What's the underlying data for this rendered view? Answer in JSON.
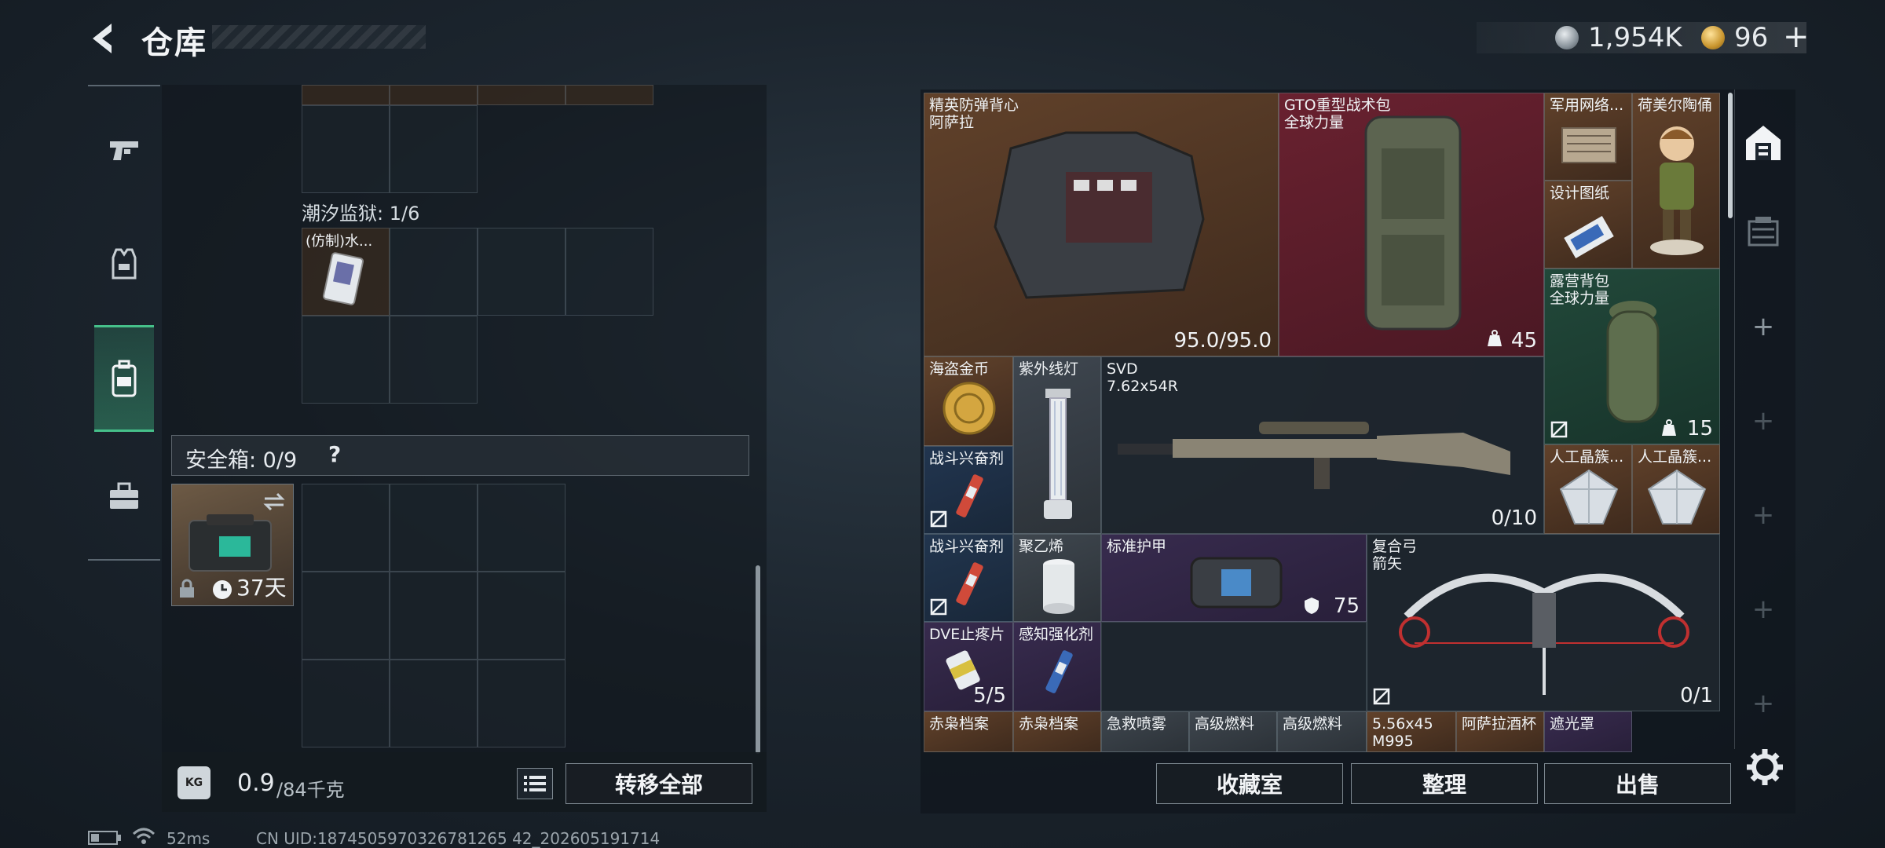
{
  "header": {
    "title": "仓库",
    "currency": {
      "silver_amount": "1,954K",
      "gold_amount": "96",
      "gold_plus": "+"
    }
  },
  "left_nav": {
    "tabs": [
      {
        "name": "weapons",
        "icon": "pistol-icon"
      },
      {
        "name": "equipment",
        "icon": "vest-icon"
      },
      {
        "name": "backpack",
        "icon": "backpack-icon",
        "active": true
      },
      {
        "name": "supplies",
        "icon": "toolbox-icon"
      }
    ]
  },
  "storage": {
    "tidal_prison_label": "潮汐监狱: 1/6",
    "tidal_item_name": "(仿制)水...",
    "safebox_label": "安全箱: 0/9",
    "safebox_help": "?",
    "safebox_days": "37天",
    "weight_value": "0.9",
    "weight_unit": "/84千克",
    "weight_icon_text": "KG",
    "transfer_all": "转移全部"
  },
  "inventory": {
    "items": [
      {
        "name": "精英防弹背心\n阿萨拉",
        "count": "95.0/95.0",
        "color": "brown"
      },
      {
        "name": "GTO重型战术包\n全球力量",
        "count": "45",
        "color": "red"
      },
      {
        "name": "军用网络...",
        "count": "",
        "color": "brown"
      },
      {
        "name": "荷美尔陶俑",
        "count": "",
        "color": "brown"
      },
      {
        "name": "设计图纸",
        "count": "",
        "color": "brown"
      },
      {
        "name": "露营背包\n全球力量",
        "count": "15",
        "color": "green"
      },
      {
        "name": "海盗金币",
        "count": "",
        "color": "brown"
      },
      {
        "name": "紫外线灯",
        "count": "",
        "color": "gray"
      },
      {
        "name": "SVD\n7.62x54R",
        "count": "0/10",
        "color": "dark"
      },
      {
        "name": "战斗兴奋剂",
        "count": "",
        "color": "blue"
      },
      {
        "name": "人工晶簇...",
        "count": "",
        "color": "brown"
      },
      {
        "name": "人工晶簇...",
        "count": "",
        "color": "brown"
      },
      {
        "name": "战斗兴奋剂",
        "count": "",
        "color": "blue"
      },
      {
        "name": "聚乙烯",
        "count": "",
        "color": "gray"
      },
      {
        "name": "标准护甲",
        "count": "75",
        "color": "purple"
      },
      {
        "name": "复合弓\n箭矢",
        "count": "0/1",
        "color": "dark"
      },
      {
        "name": "DVE止疼片",
        "count": "5/5",
        "color": "purple"
      },
      {
        "name": "感知强化剂",
        "count": "",
        "color": "purple"
      },
      {
        "name": "赤枭档案",
        "count": "",
        "color": "brown"
      },
      {
        "name": "赤枭档案",
        "count": "",
        "color": "brown"
      },
      {
        "name": "急救喷雾",
        "count": "",
        "color": "gray"
      },
      {
        "name": "高级燃料",
        "count": "",
        "color": "gray"
      },
      {
        "name": "高级燃料",
        "count": "",
        "color": "gray"
      },
      {
        "name": "5.56x45\nM995",
        "count": "",
        "color": "brown"
      },
      {
        "name": "阿萨拉酒杯",
        "count": "",
        "color": "brown"
      },
      {
        "name": "遮光罩",
        "count": "",
        "color": "purple"
      }
    ]
  },
  "actions": {
    "collection": "收藏室",
    "sort": "整理",
    "sell": "出售"
  },
  "status": {
    "ping": "52ms",
    "uid": "CN UID:1874505970326781265 42_202605191714"
  },
  "colors": {
    "accent_green": "#46c08a",
    "rarity_red": "#782232",
    "rarity_green": "#24503e",
    "rarity_purple": "#3e2e56",
    "rarity_blue": "#243a56",
    "rarity_brown": "#6e482c"
  }
}
